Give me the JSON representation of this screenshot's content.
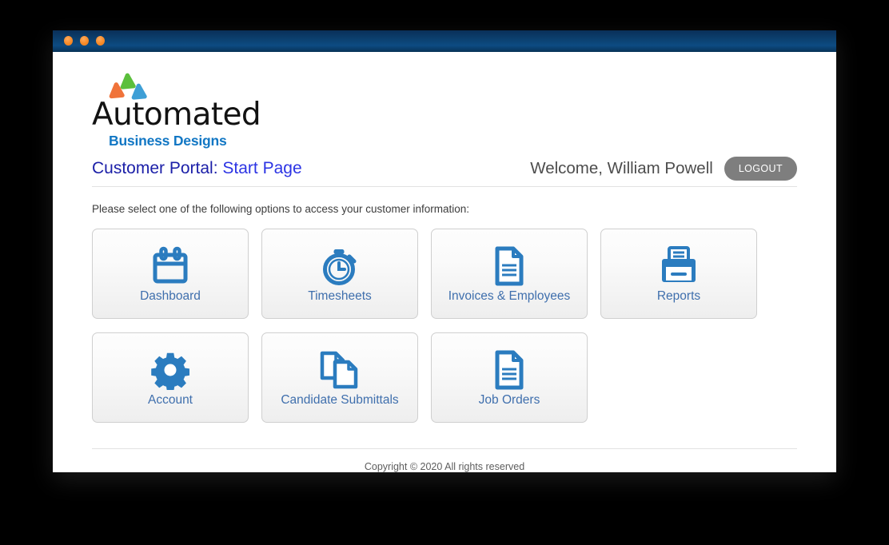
{
  "window": {
    "titlebar": {
      "dots": [
        "dot-1",
        "dot-2",
        "dot-3"
      ],
      "dot_color": "#f78a27",
      "background_top": "#0a2f59",
      "background_mid": "#0d4b82"
    }
  },
  "logo": {
    "word": "Automated",
    "subtitle": "Business Designs",
    "mark_colors": {
      "top": "#5cbf3f",
      "left": "#f0733a",
      "right": "#3e9fd6"
    },
    "subtitle_color": "#1277c4"
  },
  "header": {
    "title_main": "Customer Portal:",
    "title_sub": " Start Page",
    "welcome": "Welcome, William Powell",
    "logout_label": "LOGOUT",
    "logout_color": "#7e7e7e",
    "title_color": "#1b1fa8"
  },
  "instruction": "Please select one of the following options to access your customer information:",
  "tiles": [
    [
      {
        "label": "Dashboard",
        "icon": "calendar-icon"
      },
      {
        "label": "Timesheets",
        "icon": "stopwatch-icon"
      },
      {
        "label": "Invoices & Employees",
        "icon": "document-icon"
      },
      {
        "label": "Reports",
        "icon": "printer-icon"
      }
    ],
    [
      {
        "label": "Account",
        "icon": "gear-icon"
      },
      {
        "label": "Candidate Submittals",
        "icon": "documents-stack-icon"
      },
      {
        "label": "Job Orders",
        "icon": "document-icon"
      }
    ]
  ],
  "tile_label_color": "#3f6fad",
  "tile_icon_color": "#2b7cbf",
  "footer": {
    "copyright": "Copyright © 2020 All rights reserved"
  }
}
